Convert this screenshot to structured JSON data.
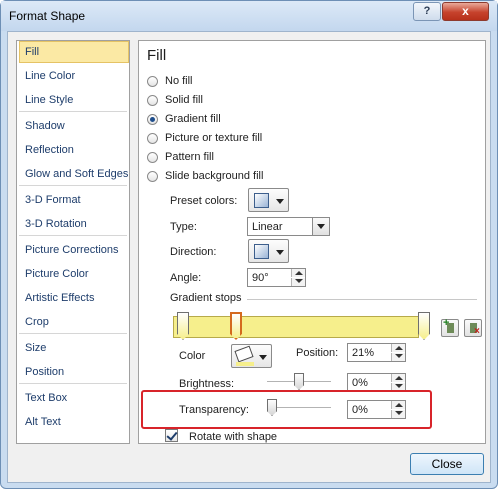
{
  "window": {
    "title": "Format Shape",
    "help_glyph": "?",
    "close_glyph": "x"
  },
  "nav": {
    "items": [
      {
        "label": "Fill",
        "selected": true
      },
      {
        "label": "Line Color"
      },
      {
        "label": "Line Style"
      },
      {
        "label": "Shadow"
      },
      {
        "label": "Reflection"
      },
      {
        "label": "Glow and Soft Edges"
      },
      {
        "label": "3-D Format"
      },
      {
        "label": "3-D Rotation"
      },
      {
        "label": "Picture Corrections"
      },
      {
        "label": "Picture Color"
      },
      {
        "label": "Artistic Effects"
      },
      {
        "label": "Crop"
      },
      {
        "label": "Size"
      },
      {
        "label": "Position"
      },
      {
        "label": "Text Box"
      },
      {
        "label": "Alt Text"
      }
    ]
  },
  "fill": {
    "heading": "Fill",
    "options": [
      {
        "label": "No fill",
        "checked": false
      },
      {
        "label": "Solid fill",
        "checked": false
      },
      {
        "label": "Gradient fill",
        "checked": true
      },
      {
        "label": "Picture or texture fill",
        "checked": false
      },
      {
        "label": "Pattern fill",
        "checked": false
      },
      {
        "label": "Slide background fill",
        "checked": false
      }
    ],
    "preset_colors_label": "Preset colors:",
    "type_label": "Type:",
    "type_value": "Linear",
    "direction_label": "Direction:",
    "angle_label": "Angle:",
    "angle_value": "90°",
    "gradient_stops_label": "Gradient stops",
    "color_label": "Color",
    "position_label": "Position:",
    "position_value": "21%",
    "brightness_label": "Brightness:",
    "brightness_value": "0%",
    "brightness_level": 0.5,
    "transparency_label": "Transparency:",
    "transparency_value": "0%",
    "transparency_level": 0.0,
    "rotate_label": "Rotate with shape",
    "rotate_checked": true,
    "gradient_color": "#f6ef8c"
  },
  "footer": {
    "close_label": "Close"
  }
}
